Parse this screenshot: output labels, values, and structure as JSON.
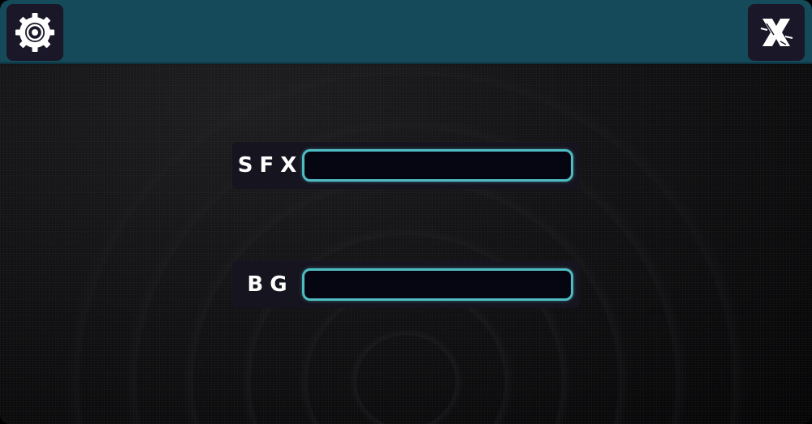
{
  "toolbar": {
    "settings_icon": "gear-icon",
    "close_icon": "close-icon"
  },
  "sliders": [
    {
      "label": "SFX",
      "value": 0
    },
    {
      "label": "BG",
      "value": 0
    }
  ],
  "colors": {
    "topbar": "#154a5a",
    "button_bg": "#1a1828",
    "accent": "#4fbcc4",
    "track_bg": "#050612",
    "panel_bg": "#16141f"
  }
}
